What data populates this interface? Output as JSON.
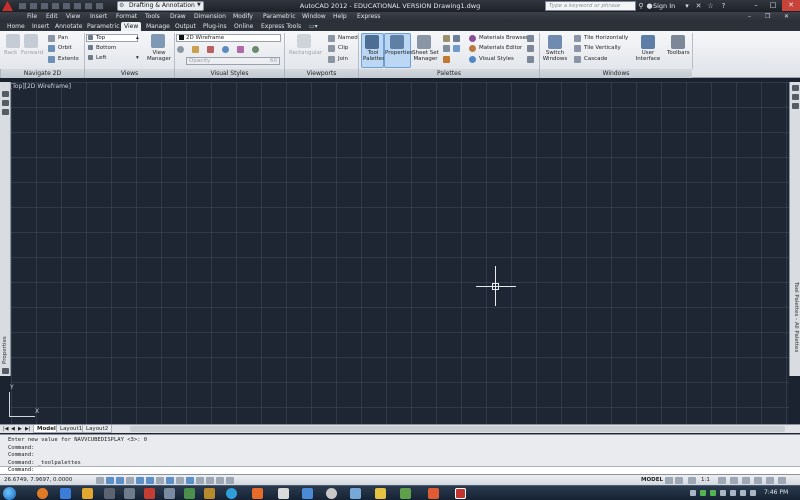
{
  "window": {
    "workspace": "Drafting & Annotation",
    "title": "AutoCAD 2012 - EDUCATIONAL VERSION   Drawing1.dwg",
    "search_placeholder": "Type a keyword or phrase",
    "signin": "Sign In"
  },
  "menus": [
    "File",
    "Edit",
    "View",
    "Insert",
    "Format",
    "Tools",
    "Draw",
    "Dimension",
    "Modify",
    "Parametric",
    "Window",
    "Help",
    "Express"
  ],
  "ribbon_tabs": [
    {
      "label": "Home",
      "active": false
    },
    {
      "label": "Insert",
      "active": false
    },
    {
      "label": "Annotate",
      "active": false
    },
    {
      "label": "Parametric",
      "active": false
    },
    {
      "label": "View",
      "active": true
    },
    {
      "label": "Manage",
      "active": false
    },
    {
      "label": "Output",
      "active": false
    },
    {
      "label": "Plug-ins",
      "active": false
    },
    {
      "label": "Online",
      "active": false
    },
    {
      "label": "Express Tools",
      "active": false
    }
  ],
  "ribbon": {
    "navigate": {
      "back": "Back",
      "forward": "Forward",
      "pan": "Pan",
      "orbit": "Orbit",
      "extents": "Extents",
      "title": "Navigate 2D"
    },
    "views": {
      "top": "Top",
      "bottom": "Bottom",
      "left": "Left",
      "view_manager": "View Manager",
      "title": "Views"
    },
    "visual_styles": {
      "style": "2D Wireframe",
      "opacity": "Opacity",
      "opacity_value": "60",
      "title": "Visual Styles"
    },
    "viewports": {
      "rectangular": "Rectangular",
      "named": "Named",
      "clip": "Clip",
      "join": "Join",
      "title": "Viewports"
    },
    "palettes": {
      "tool_palettes": "Tool Palettes",
      "properties": "Properties",
      "sheet_set": "Sheet Set Manager",
      "materials_browser": "Materials Browser",
      "materials_editor": "Materials Editor",
      "visual_styles": "Visual Styles",
      "title": "Palettes"
    },
    "windows": {
      "switch": "Switch Windows",
      "tile_h": "Tile Horizontally",
      "tile_v": "Tile Vertically",
      "cascade": "Cascade",
      "user_interface": "User Interface",
      "toolbars": "Toolbars",
      "title": "Windows"
    }
  },
  "viewport_label": "[-][Top][2D Wireframe]",
  "left_palette_label": "Properties",
  "right_palette_label": "Tool Palettes - All Palettes",
  "ucs": {
    "x": "X",
    "y": "Y"
  },
  "layout_tabs": [
    {
      "label": "Model",
      "active": true
    },
    {
      "label": "Layout1",
      "active": false
    },
    {
      "label": "Layout2",
      "active": false
    }
  ],
  "command_history": [
    "Enter new value for NAVVCUBEDISPLAY <3>: 0",
    "Command:",
    "Command:",
    "Command: _toolpalettes"
  ],
  "command_prompt": "Command:",
  "status": {
    "coords": "26.6749, 7.9697, 0.0000",
    "model": "MODEL",
    "scale": "1:1"
  },
  "clock": "7:46 PM"
}
